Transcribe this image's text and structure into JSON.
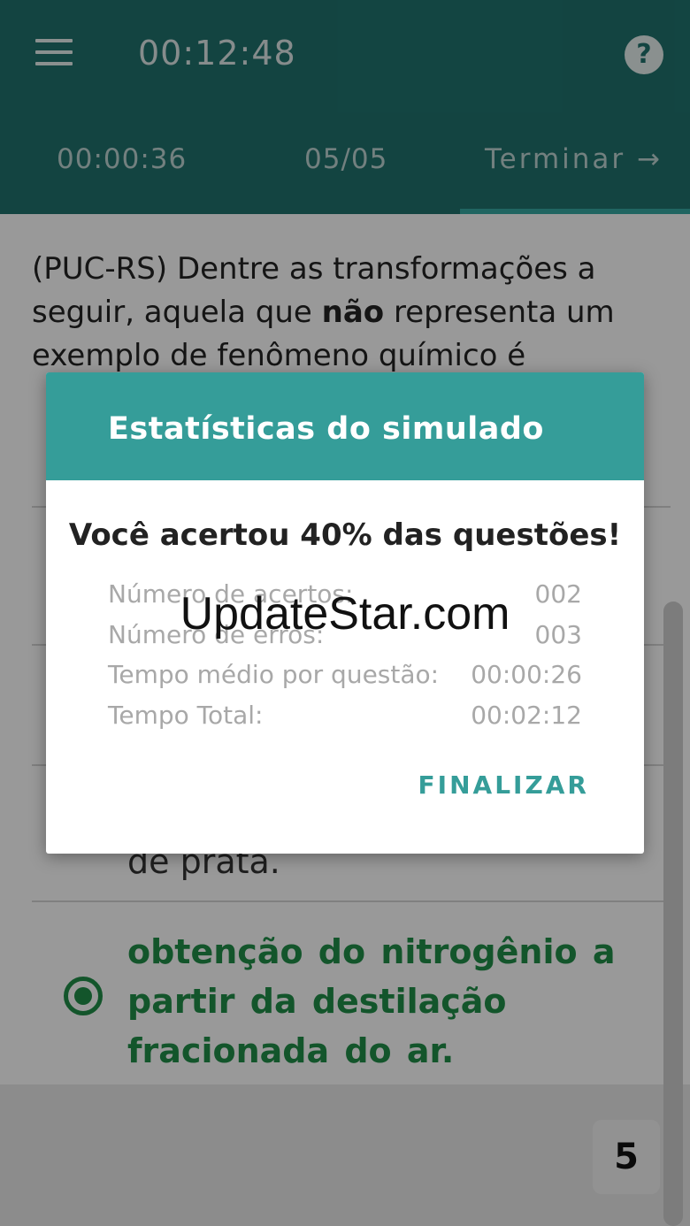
{
  "appbar": {
    "clock": "00:12:48",
    "tabs": {
      "question_time": "00:00:36",
      "question_count": "05/05",
      "finish": "Terminar →"
    }
  },
  "question": {
    "text_before": "(PUC-RS) Dentre as transformações a seguir, aquela que ",
    "text_bold": "não",
    "text_after": " representa um exemplo de fenômeno químico é"
  },
  "options": {
    "partial_visible": "de prata.",
    "selected": "obtenção do nitrogênio a partir da destilação fracionada do ar."
  },
  "page_badge": "5",
  "dialog": {
    "title": "Estatísticas do simulado",
    "score": "Você acertou 40% das questões!",
    "stats": [
      {
        "label": "Número de acertos:",
        "value": "002"
      },
      {
        "label": "Número de erros:",
        "value": "003"
      },
      {
        "label": "Tempo médio por questão:",
        "value": "00:00:26"
      },
      {
        "label": "Tempo Total:",
        "value": "00:02:12"
      }
    ],
    "finish_button": "FINALIZAR"
  },
  "watermark": "UpdateStar.com",
  "colors": {
    "appbar": "#1f6f6a",
    "dialog_header": "#359d99",
    "selected_option": "#1f8a46"
  }
}
